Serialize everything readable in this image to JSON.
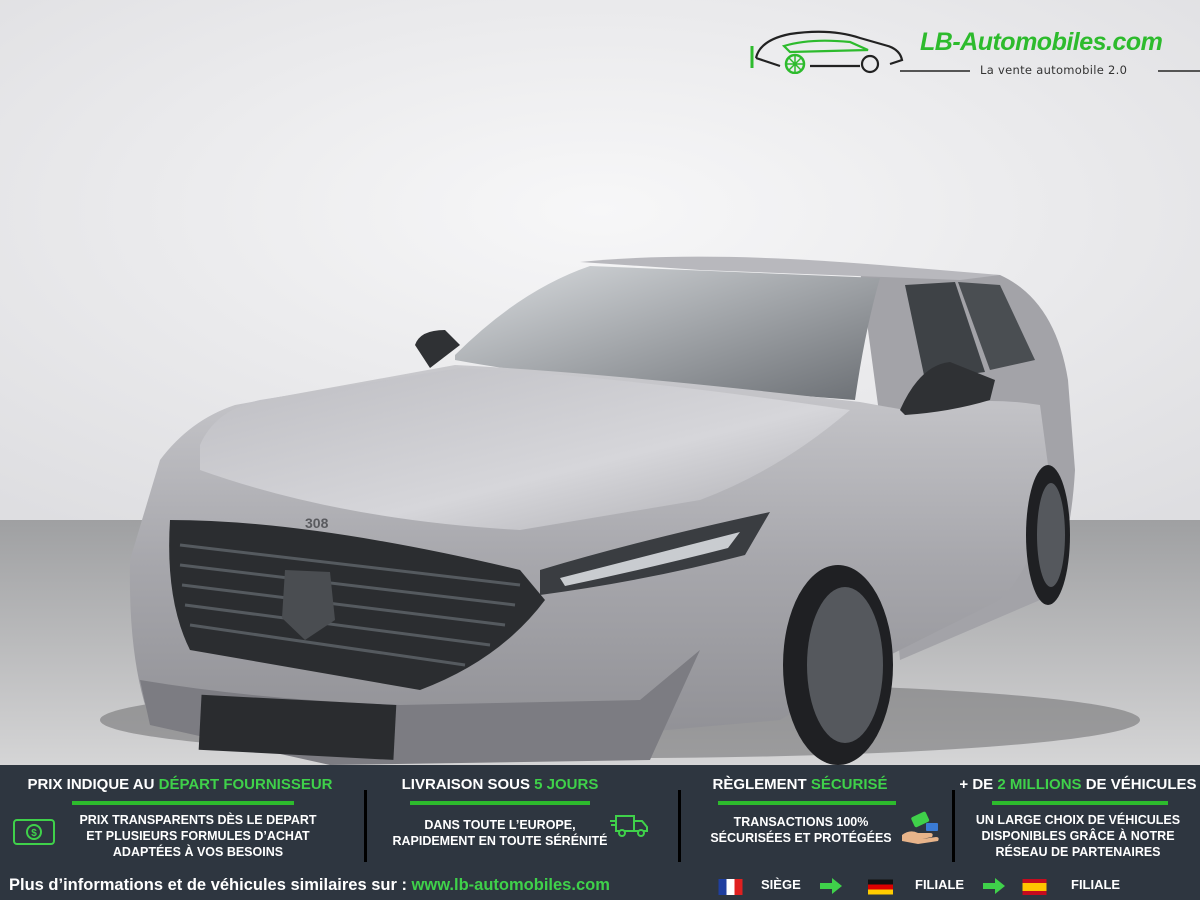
{
  "brand": {
    "name": "LB-Automobiles.com",
    "tagline": "La vente automobile 2.0",
    "accent_color": "#2dbb2d",
    "banner_color": "#2e3640"
  },
  "vehicle": {
    "badge": "308",
    "paint_color": "#a9a9ae"
  },
  "features": [
    {
      "title_pre": "PRIX INDIQUE AU ",
      "title_hl": "DÉPART FOURNISSEUR",
      "title_post": "",
      "lines": [
        "PRIX TRANSPARENTS DÈS LE DEPART",
        "ET PLUSIEURS FORMULES D’ACHAT",
        "ADAPTÉES À VOS BESOINS"
      ],
      "icon": "money-icon"
    },
    {
      "title_pre": "LIVRAISON SOUS ",
      "title_hl": "5 JOURS",
      "title_post": "",
      "lines": [
        "DANS TOUTE L’EUROPE,",
        "RAPIDEMENT EN TOUTE SÉRÉNITÉ"
      ],
      "icon": "delivery-truck-icon"
    },
    {
      "title_pre": "RÈGLEMENT ",
      "title_hl": "SÉCURISÉ",
      "title_post": "",
      "lines": [
        "TRANSACTIONS 100%",
        "SÉCURISÉES ET PROTÉGÉES"
      ],
      "icon": "payment-hand-icon"
    },
    {
      "title_pre": "+ DE ",
      "title_hl": "2 MILLIONS",
      "title_post": " DE VÉHICULES",
      "lines": [
        "UN LARGE CHOIX DE VÉHICULES",
        "DISPONIBLES GRÂCE À NOTRE",
        "RÉSEAU DE PARTENAIRES"
      ],
      "icon": ""
    }
  ],
  "footer": {
    "text": "Plus d’informations et de véhicules similaires sur : ",
    "url": "www.lb-automobiles.com",
    "locations": [
      {
        "flag": "france-flag-icon",
        "label": "SIÈGE"
      },
      {
        "flag": "germany-flag-icon",
        "label": "FILIALE"
      },
      {
        "flag": "spain-flag-icon",
        "label": "FILIALE"
      }
    ]
  }
}
